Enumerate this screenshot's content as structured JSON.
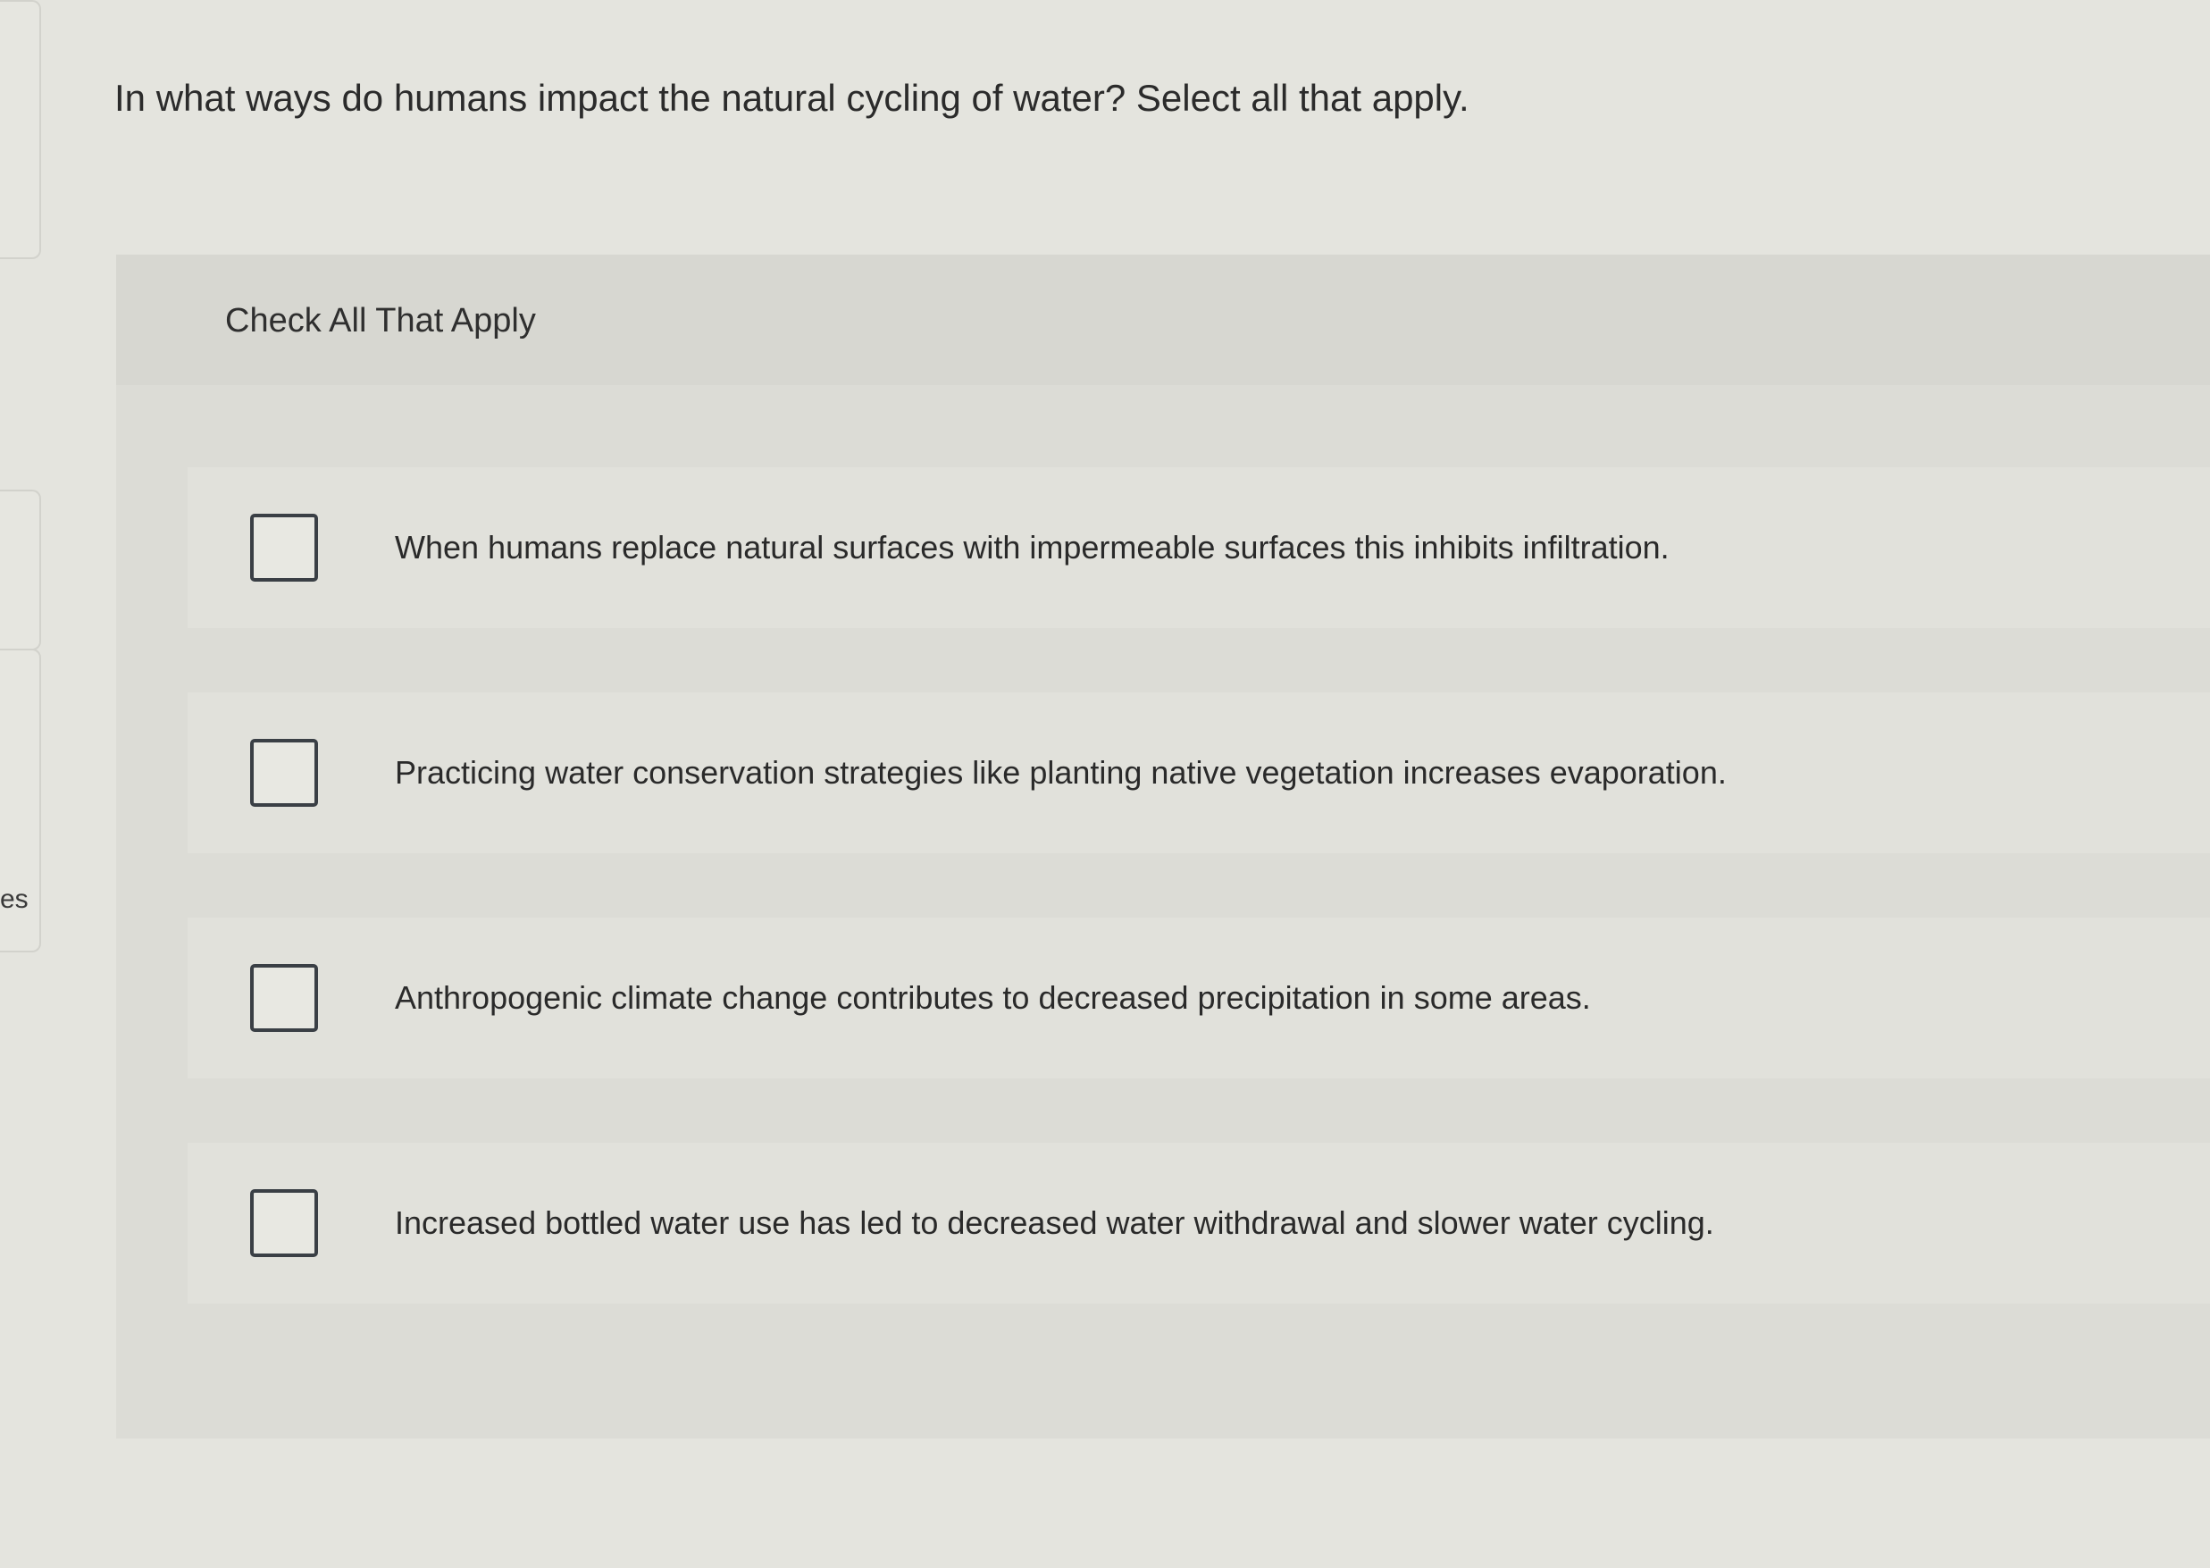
{
  "sidebar": {
    "partial_text": "es"
  },
  "question": {
    "text": "In what ways do humans impact the natural cycling of water? Select all that apply."
  },
  "answers": {
    "header": "Check All That Apply",
    "options": [
      {
        "label": "When humans replace natural surfaces with impermeable surfaces this inhibits infiltration.",
        "checked": false
      },
      {
        "label": "Practicing water conservation strategies like planting native vegetation increases evaporation.",
        "checked": false
      },
      {
        "label": "Anthropogenic climate change contributes to decreased precipitation in some areas.",
        "checked": false
      },
      {
        "label": "Increased bottled water use has led to decreased water withdrawal and slower water cycling.",
        "checked": false
      }
    ]
  }
}
